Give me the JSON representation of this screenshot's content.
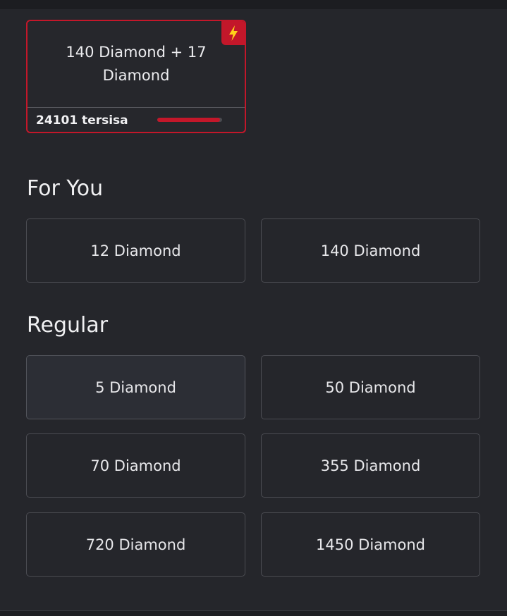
{
  "flash_sale": {
    "title": "140 Diamond + 17 Diamond",
    "stock_text": "24101 tersisa",
    "progress_fraction": 0.97,
    "badge_icon": "lightning-icon",
    "accent_color": "#c3172a"
  },
  "sections": {
    "for_you": {
      "title": "For You",
      "items": [
        "12 Diamond",
        "140 Diamond"
      ]
    },
    "regular": {
      "title": "Regular",
      "items": [
        "5 Diamond",
        "50 Diamond",
        "70 Diamond",
        "355 Diamond",
        "720 Diamond",
        "1450 Diamond"
      ],
      "selected_index": 0
    }
  }
}
